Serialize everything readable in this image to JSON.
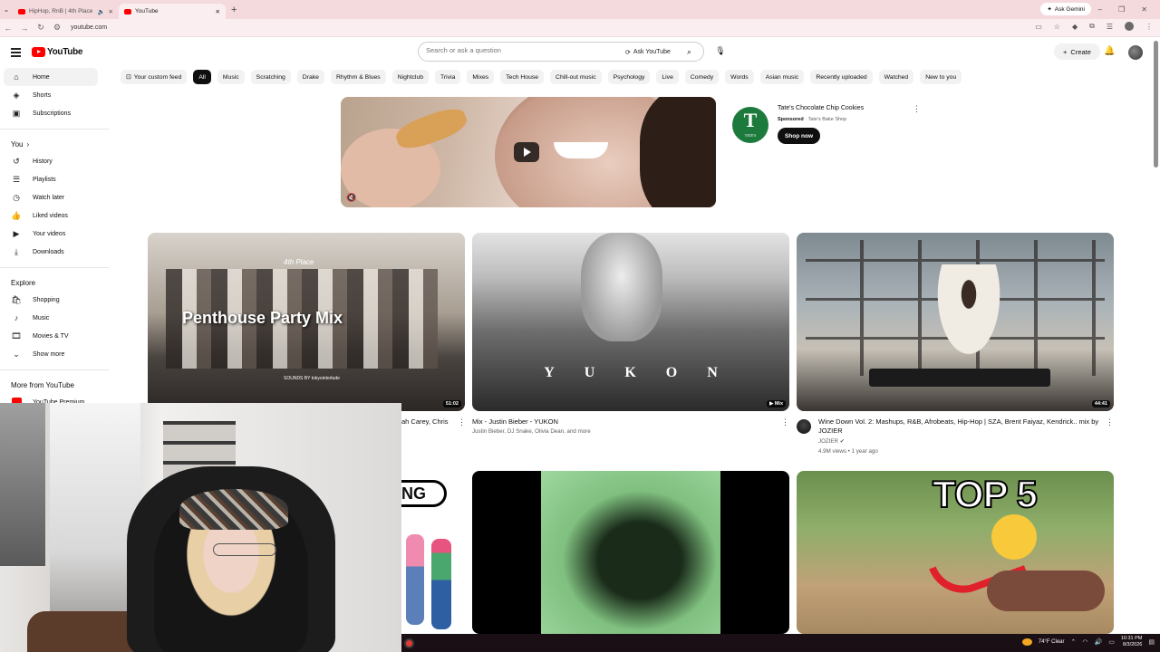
{
  "browser": {
    "tabs": [
      {
        "title": "HipHop, RnB | 4th Place | t...",
        "active": false
      },
      {
        "title": "YouTube",
        "active": true
      }
    ],
    "ask_gemini": "Ask Gemini",
    "url": "youtube.com"
  },
  "header": {
    "logo_text": "YouTube",
    "search_placeholder": "Search or ask a question",
    "ask_youtube": "Ask YouTube",
    "create_label": "Create"
  },
  "sidebar": {
    "main": [
      {
        "label": "Home",
        "icon": "home-icon"
      },
      {
        "label": "Shorts",
        "icon": "shorts-icon"
      },
      {
        "label": "Subscriptions",
        "icon": "subscriptions-icon"
      }
    ],
    "you_heading": "You",
    "you": [
      {
        "label": "History",
        "icon": "history-icon"
      },
      {
        "label": "Playlists",
        "icon": "playlists-icon"
      },
      {
        "label": "Watch later",
        "icon": "watch-later-icon"
      },
      {
        "label": "Liked videos",
        "icon": "thumbs-up-icon"
      },
      {
        "label": "Your videos",
        "icon": "your-videos-icon"
      },
      {
        "label": "Downloads",
        "icon": "download-icon"
      }
    ],
    "explore_heading": "Explore",
    "explore": [
      {
        "label": "Shopping",
        "icon": "shopping-bag-icon"
      },
      {
        "label": "Music",
        "icon": "music-note-icon"
      },
      {
        "label": "Movies & TV",
        "icon": "film-icon"
      },
      {
        "label": "Show more",
        "icon": "chevron-down-icon"
      }
    ],
    "more_heading": "More from YouTube",
    "more": [
      {
        "label": "YouTube Premium",
        "icon": "youtube-premium-icon"
      }
    ]
  },
  "chips": [
    "Your custom feed",
    "All",
    "Music",
    "Scratching",
    "Drake",
    "Rhythm & Blues",
    "Nightclub",
    "Trivia",
    "Mixes",
    "Tech House",
    "Chill-out music",
    "Psychology",
    "Live",
    "Comedy",
    "Words",
    "Asian music",
    "Recently uploaded",
    "Watched",
    "New to you"
  ],
  "ad": {
    "title": "Tate's Chocolate Chip Cookies",
    "sponsored": "Sponsored",
    "advertiser": "Tate's Bake Shop",
    "button": "Shop now",
    "logo_letter": "T",
    "logo_sub": "TATE'S"
  },
  "videos": [
    {
      "thumb_text": "Penthouse Party Mix",
      "thumb_sub": "4th Place",
      "thumb_sounds": "SOUNDS BY tokyointerlude",
      "duration": "51:02",
      "title": "ah Carey, Chris",
      "channel": "",
      "meta": ""
    },
    {
      "thumb_text": "YUKON",
      "duration": "Mix",
      "title": "Mix - Justin Bieber - YUKON",
      "channel": "Justin Bieber, DJ Snake, Olivia Dean, and more",
      "meta": ""
    },
    {
      "duration": "44:41",
      "title": "Wine Down Vol. 2: Mashups, R&B, Afrobeats, Hip-Hop | SZA, Brent Faiyaz, Kendrick.. mix by JOZIER",
      "channel": "JOZIER",
      "meta": "4.9M views • 1 year ago"
    },
    {
      "thumb_text": "NG"
    },
    {
      "thumb_text": ""
    },
    {
      "thumb_text": "TOP 5"
    }
  ],
  "taskbar": {
    "weather": "74°F  Clear",
    "time": "10:31 PM",
    "date": "8/3/2026"
  }
}
